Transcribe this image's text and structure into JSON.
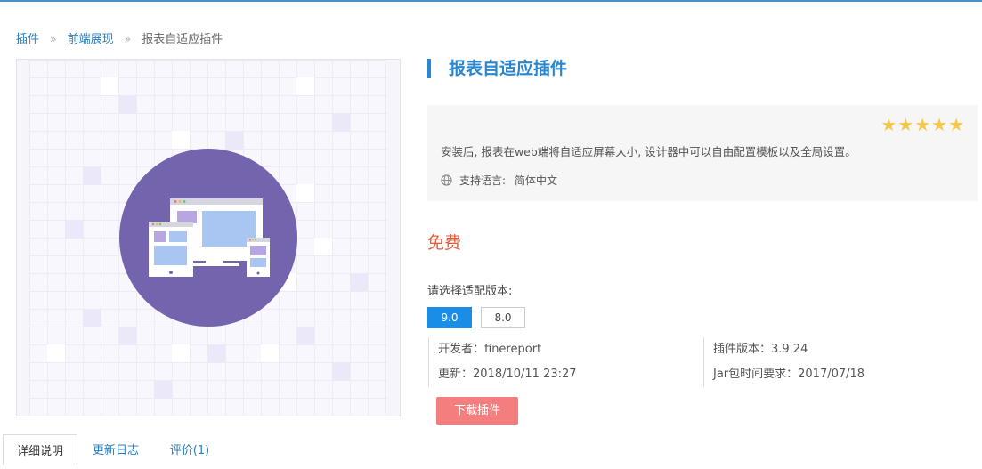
{
  "breadcrumb": {
    "items": [
      "插件",
      "前端展现",
      "报表自适应插件"
    ],
    "separator": "»"
  },
  "plugin": {
    "title": "报表自适应插件",
    "rating_stars": 5,
    "stars_text": "★★★★★",
    "description": "安装后, 报表在web端将自适应屏幕大小, 设计器中可以自由配置模板以及全局设置。",
    "language_label": "支持语言:",
    "language_value": "简体中文",
    "price": "免费"
  },
  "version": {
    "label": "请选择适配版本:",
    "options": [
      "9.0",
      "8.0"
    ],
    "selected": "9.0"
  },
  "meta": {
    "developer": "开发者：finereport",
    "updated": "更新：2018/10/11 23:27",
    "plugin_version": "插件版本：3.9.24",
    "jar_requirement": "Jar包时间要求：2017/07/18"
  },
  "download_label": "下载插件",
  "tabs": [
    "详细说明",
    "更新日志",
    "评价(1)"
  ],
  "colors": {
    "accent": "#2a86cf",
    "price": "#e95b3a",
    "download": "#f47e7e",
    "version_active": "#1a8de6",
    "illustration": "#7464ae",
    "star": "#f5c84c"
  }
}
